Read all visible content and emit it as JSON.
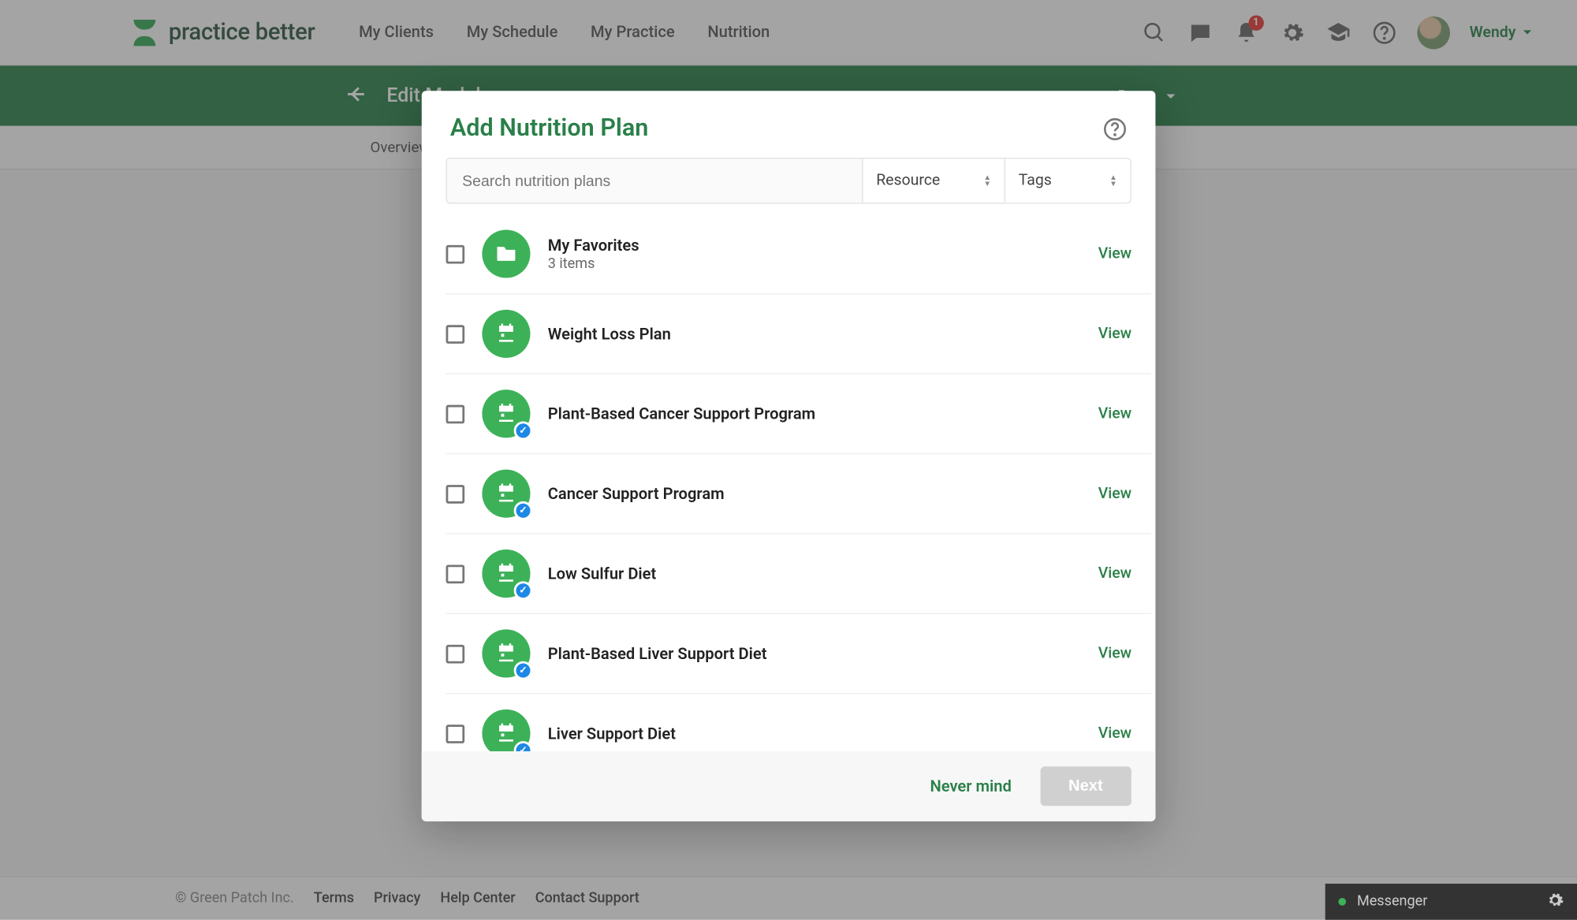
{
  "brand": {
    "name": "practice better"
  },
  "nav": {
    "links": [
      "My Clients",
      "My Schedule",
      "My Practice",
      "Nutrition"
    ],
    "notification_count": "1",
    "user_name": "Wendy"
  },
  "greenbar": {
    "title": "Edit Module",
    "done": "Done"
  },
  "subnav": {
    "tabs": [
      "Overview"
    ]
  },
  "modal": {
    "title": "Add Nutrition Plan",
    "search_placeholder": "Search nutrition plans",
    "filter_resource": "Resource",
    "filter_tags": "Tags",
    "view_label": "View",
    "favorites": {
      "title": "My Favorites",
      "sub": "3 items"
    },
    "plans": [
      {
        "title": "Weight Loss Plan",
        "badge": false
      },
      {
        "title": "Plant-Based Cancer Support Program",
        "badge": true
      },
      {
        "title": "Cancer Support Program",
        "badge": true
      },
      {
        "title": "Low Sulfur Diet",
        "badge": true
      },
      {
        "title": "Plant-Based Liver Support Diet",
        "badge": true
      },
      {
        "title": "Liver Support Diet",
        "badge": true
      }
    ],
    "cancel": "Never mind",
    "next": "Next"
  },
  "footer": {
    "copyright": "© Green Patch Inc.",
    "links": [
      "Terms",
      "Privacy",
      "Help Center",
      "Contact Support"
    ]
  },
  "messenger": {
    "label": "Messenger"
  }
}
